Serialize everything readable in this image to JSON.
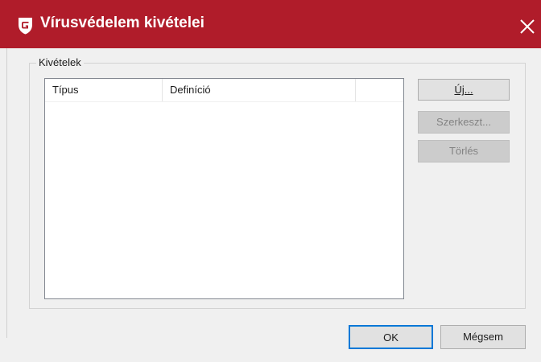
{
  "window": {
    "title": "Vírusvédelem kivételei",
    "brand_color": "#b01c2a",
    "logo_icon": "g-data-shield-icon",
    "close_icon": "close-icon"
  },
  "exceptions": {
    "group_label": "Kivételek",
    "columns": [
      "Típus",
      "Definíció"
    ],
    "rows": []
  },
  "side_buttons": {
    "new_label": "Új...",
    "edit_label": "Szerkeszt...",
    "delete_label": "Törlés"
  },
  "footer": {
    "ok_label": "OK",
    "cancel_label": "Mégsem"
  }
}
